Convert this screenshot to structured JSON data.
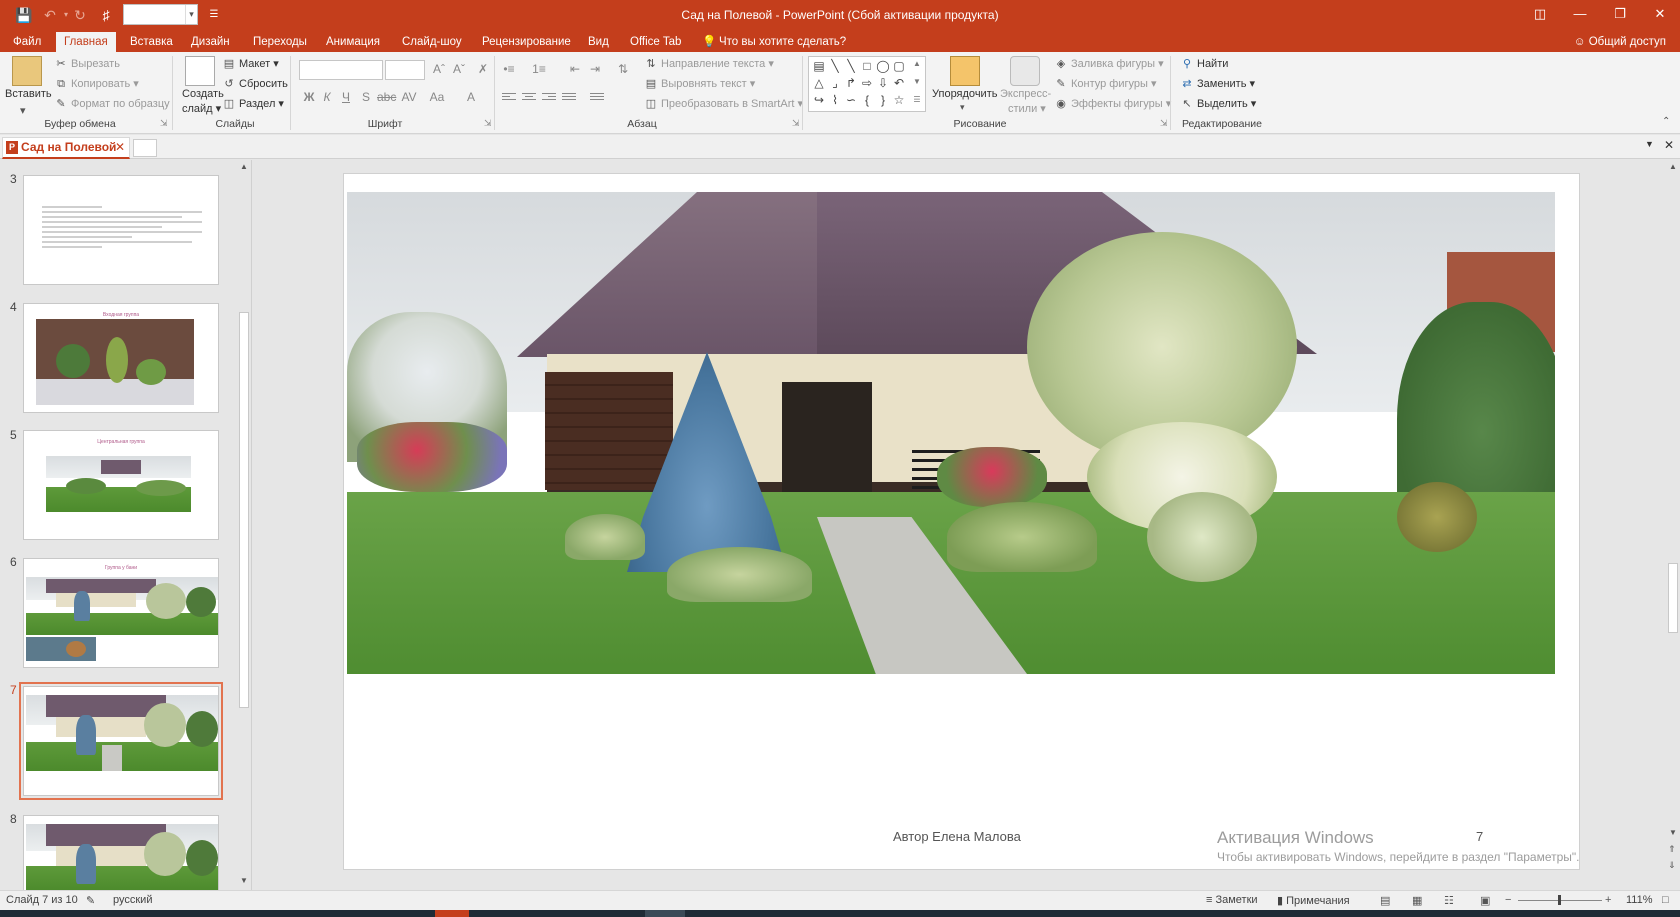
{
  "window": {
    "title": "Сад на Полевой - PowerPoint (Сбой активации продукта)"
  },
  "tabs": [
    "Файл",
    "Главная",
    "Вставка",
    "Дизайн",
    "Переходы",
    "Анимация",
    "Слайд-шоу",
    "Рецензирование",
    "Вид",
    "Office Tab"
  ],
  "tell_me": "Что вы хотите сделать?",
  "share": "Общий доступ",
  "ribbon": {
    "clipboard": {
      "paste": "Вставить",
      "cut": "Вырезать",
      "copy": "Копировать",
      "format_painter": "Формат по образцу",
      "label": "Буфер обмена"
    },
    "slides": {
      "new_slide_1": "Создать",
      "new_slide_2": "слайд",
      "layout": "Макет",
      "reset": "Сбросить",
      "section": "Раздел",
      "label": "Слайды"
    },
    "font": {
      "bold": "Ж",
      "italic": "К",
      "underline": "Ч",
      "strike": "S",
      "label": "Шрифт"
    },
    "paragraph": {
      "text_direction": "Направление текста",
      "align_text": "Выровнять текст",
      "smartart": "Преобразовать в SmartArt",
      "label": "Абзац"
    },
    "drawing": {
      "arrange": "Упорядочить",
      "quick_styles_1": "Экспресс-",
      "quick_styles_2": "стили",
      "fill": "Заливка фигуры",
      "outline": "Контур фигуры",
      "effects": "Эффекты фигуры",
      "label": "Рисование"
    },
    "editing": {
      "find": "Найти",
      "replace": "Заменить",
      "select": "Выделить",
      "label": "Редактирование"
    }
  },
  "doc_tab": {
    "name": "Сад на Полевой"
  },
  "thumbnails": [
    {
      "num": "3",
      "title": ""
    },
    {
      "num": "4",
      "title": "Входная группа"
    },
    {
      "num": "5",
      "title": "Центральная группа"
    },
    {
      "num": "6",
      "title": "Группа у бани"
    },
    {
      "num": "7",
      "title": ""
    },
    {
      "num": "8",
      "title": ""
    }
  ],
  "slide": {
    "footer": "Автор Елена Малова",
    "number": "7"
  },
  "activation": {
    "title": "Активация Windows",
    "subtitle": "Чтобы активировать Windows, перейдите в раздел \"Параметры\"."
  },
  "status": {
    "slide_info": "Слайд 7 из 10",
    "language": "русский",
    "notes": "Заметки",
    "comments": "Примечания",
    "zoom": "111%"
  },
  "colors": {
    "accent": "#c43e1c",
    "selection": "#e2734f"
  }
}
